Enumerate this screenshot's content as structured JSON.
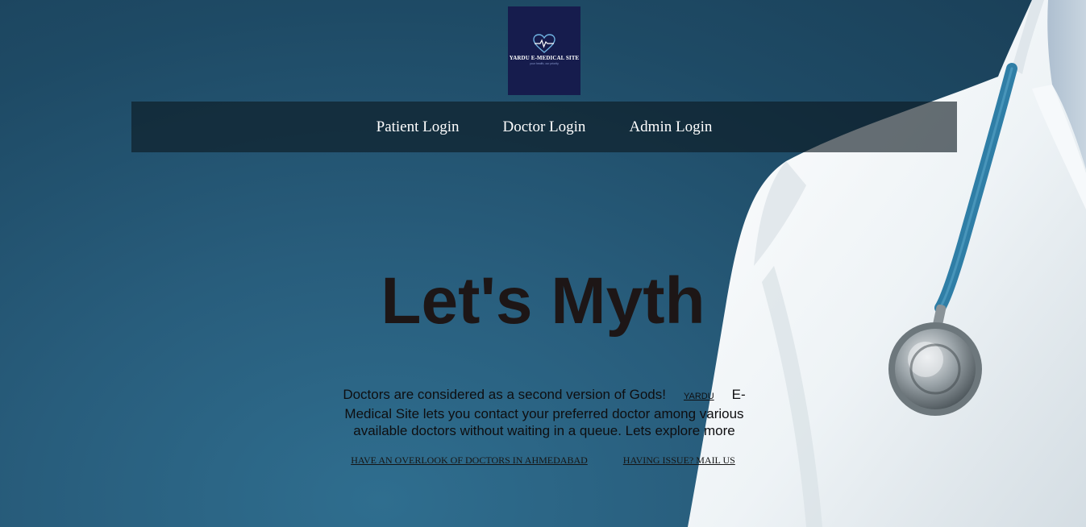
{
  "logo": {
    "title": "YARDU E-MEDICAL SITE",
    "tagline": "your health, our priority",
    "background": "#161c4d",
    "icon": "heart-pulse-icon"
  },
  "nav": {
    "items": [
      {
        "label": "Patient Login"
      },
      {
        "label": "Doctor Login"
      },
      {
        "label": "Admin Login"
      }
    ]
  },
  "hero": {
    "headline": "Let's Myth",
    "description_part1": "Doctors are considered as a second version of Gods!",
    "inline_link": "YARDU",
    "description_part2": "E-Medical Site lets you contact your preferred doctor among various available doctors without waiting in a queue. Lets explore more",
    "links": [
      {
        "label": "HAVE AN OVERLOOK OF DOCTORS IN AHMEDABAD"
      },
      {
        "label": "HAVING ISSUE? MAIL US"
      }
    ]
  },
  "colors": {
    "background": "#285d7c",
    "navbar": "#0c1820",
    "headline": "#1d1616",
    "stethoscope_tube": "#2f7ea6"
  }
}
